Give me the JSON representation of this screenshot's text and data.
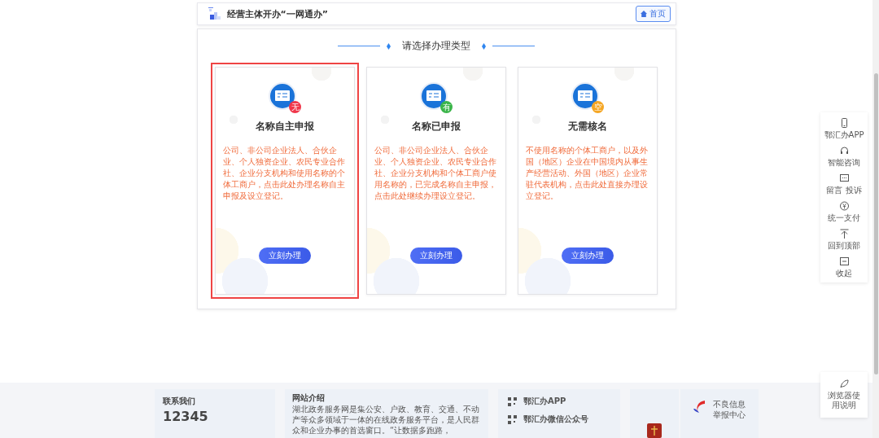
{
  "header": {
    "title": "经营主体开办“一网通办”",
    "home_button": "首页"
  },
  "panel": {
    "heading": "请选择办理类型"
  },
  "cards": [
    {
      "title": "名称自主申报",
      "badge": "无",
      "color": "#f0364a",
      "description": "公司、非公司企业法人、合伙企业、个人独资企业、农民专业合作社、企业分支机构和使用名称的个体工商户，点击此处办理名称自主申报及设立登记。",
      "button": "立刻办理",
      "selected": true
    },
    {
      "title": "名称已申报",
      "badge": "有",
      "color": "#3bb54a",
      "description": "公司、非公司企业法人、合伙企业、个人独资企业、农民专业合作社、企业分支机构和个体工商户使用名称的，已完成名称自主申报，点击此处继续办理设立登记。",
      "button": "立刻办理",
      "selected": false
    },
    {
      "title": "无需核名",
      "badge": "空",
      "color": "#f5a623",
      "description": "不使用名称的个体工商户，以及外国（地区）企业在中国境内从事生产经营活动、外国（地区）企业常驻代表机构，点击此处直接办理设立登记。",
      "button": "立刻办理",
      "selected": false
    }
  ],
  "side_tools": [
    {
      "kind": "phone",
      "label": "鄂汇办APP"
    },
    {
      "kind": "headset",
      "label": "智能咨询"
    },
    {
      "kind": "message",
      "label": "留言 投诉"
    },
    {
      "kind": "yuan",
      "label": "统一支付"
    },
    {
      "kind": "top",
      "label": "回到顶部"
    },
    {
      "kind": "collapse",
      "label": "收起"
    }
  ],
  "browser_help": {
    "label": "浏览器使用说明"
  },
  "footer": {
    "contact": {
      "title": "联系我们",
      "number": "12345"
    },
    "about": {
      "title": "网站介绍",
      "text": "湖北政务服务网是集公安、户政、教育、交通、不动产等众多领域于一体的在线政务服务平台，是人民群众和企业办事的首选窗口。“让数据多跑路，"
    },
    "qr_links": [
      "鄂汇办APP",
      "鄂汇办微信公众号"
    ],
    "report": {
      "label": "不良信息举报中心"
    }
  }
}
